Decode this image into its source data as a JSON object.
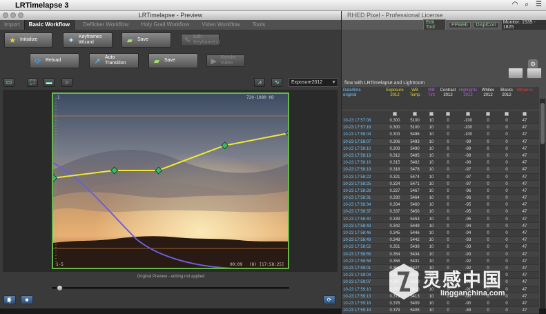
{
  "menubar": {
    "app_name": "LRTimelapse 3"
  },
  "bg_window": {
    "title": "RHED Pixel - Professional License",
    "chips": [
      "Edit Tool",
      "PPWeb",
      "DisplCorr"
    ],
    "monitor": "Monitor: 1535 - 1825",
    "caption": "flow with LRTimelapse and Lightroom"
  },
  "table": {
    "headers": [
      {
        "line1": "Date/time",
        "line2": "original",
        "cls": ""
      },
      {
        "line1": "Exposure",
        "line2": "2012",
        "cls": "exp"
      },
      {
        "line1": "WB",
        "line2": "Temp",
        "cls": "wb"
      },
      {
        "line1": "WB",
        "line2": "Tint",
        "cls": "tint"
      },
      {
        "line1": "Contrast",
        "line2": "2012",
        "cls": ""
      },
      {
        "line1": "Highlights",
        "line2": "2012",
        "cls": "hl"
      },
      {
        "line1": "Whites",
        "line2": "2012",
        "cls": ""
      },
      {
        "line1": "Blacks",
        "line2": "2012",
        "cls": ""
      },
      {
        "line1": "Vibrance",
        "line2": "",
        "cls": "vib"
      }
    ],
    "rows": [
      [
        "10-23 17:57:08",
        "0.300",
        "5100",
        "10",
        "0",
        "-100",
        "0",
        "0",
        "47"
      ],
      [
        "10-23 17:57:16",
        "0.300",
        "5100",
        "10",
        "0",
        "-100",
        "0",
        "0",
        "47"
      ],
      [
        "10-23 17:58:04",
        "0.303",
        "5496",
        "10",
        "0",
        "-100",
        "0",
        "0",
        "47"
      ],
      [
        "10-23 17:58:07",
        "0.306",
        "5493",
        "10",
        "0",
        "-99",
        "0",
        "0",
        "47"
      ],
      [
        "10-23 17:58:10",
        "0.309",
        "5490",
        "10",
        "0",
        "-99",
        "0",
        "0",
        "47"
      ],
      [
        "10-23 17:58:13",
        "0.312",
        "5485",
        "10",
        "0",
        "-98",
        "0",
        "0",
        "47"
      ],
      [
        "10-23 17:58:16",
        "0.315",
        "5482",
        "10",
        "0",
        "-98",
        "0",
        "0",
        "47"
      ],
      [
        "10-23 17:58:19",
        "0.318",
        "5478",
        "10",
        "0",
        "-97",
        "0",
        "0",
        "47"
      ],
      [
        "10-23 17:58:22",
        "0.321",
        "5474",
        "10",
        "0",
        "-97",
        "0",
        "0",
        "47"
      ],
      [
        "10-23 17:58:25",
        "0.324",
        "5471",
        "10",
        "0",
        "-97",
        "0",
        "0",
        "47"
      ],
      [
        "10-23 17:58:28",
        "0.327",
        "5467",
        "10",
        "0",
        "-96",
        "0",
        "0",
        "47"
      ],
      [
        "10-23 17:58:31",
        "0.330",
        "5464",
        "10",
        "0",
        "-96",
        "0",
        "0",
        "47"
      ],
      [
        "10-23 17:58:34",
        "0.334",
        "5460",
        "10",
        "0",
        "-95",
        "0",
        "0",
        "47"
      ],
      [
        "10-23 17:58:37",
        "0.337",
        "5456",
        "10",
        "0",
        "-95",
        "0",
        "0",
        "47"
      ],
      [
        "10-23 17:58:40",
        "0.339",
        "5453",
        "10",
        "0",
        "-95",
        "0",
        "0",
        "47"
      ],
      [
        "10-23 17:58:43",
        "0.342",
        "5449",
        "10",
        "0",
        "-94",
        "0",
        "0",
        "47"
      ],
      [
        "10-23 17:58:46",
        "0.345",
        "5446",
        "10",
        "0",
        "-94",
        "0",
        "0",
        "47"
      ],
      [
        "10-23 17:58:49",
        "0.348",
        "5442",
        "10",
        "0",
        "-93",
        "0",
        "0",
        "47"
      ],
      [
        "10-23 17:58:52",
        "0.351",
        "5438",
        "10",
        "0",
        "-93",
        "0",
        "0",
        "47"
      ],
      [
        "10-23 17:58:55",
        "0.354",
        "5434",
        "10",
        "0",
        "-93",
        "0",
        "0",
        "47"
      ],
      [
        "10-23 17:58:58",
        "0.358",
        "5431",
        "10",
        "0",
        "-92",
        "0",
        "0",
        "47"
      ],
      [
        "10-23 17:59:01",
        "0.361",
        "5427",
        "10",
        "0",
        "-92",
        "0",
        "0",
        "47"
      ],
      [
        "10-23 17:59:04",
        "0.364",
        "5424",
        "10",
        "0",
        "-91",
        "0",
        "0",
        "47"
      ],
      [
        "10-23 17:59:07",
        "0.367",
        "5420",
        "10",
        "0",
        "-91",
        "0",
        "0",
        "47"
      ],
      [
        "10-23 17:59:10",
        "0.370",
        "5416",
        "10",
        "0",
        "-91",
        "0",
        "0",
        "47"
      ],
      [
        "10-23 17:59:13",
        "0.373",
        "5413",
        "10",
        "0",
        "-90",
        "0",
        "0",
        "47"
      ],
      [
        "10-23 17:59:16",
        "0.376",
        "5409",
        "10",
        "0",
        "-90",
        "0",
        "0",
        "47"
      ],
      [
        "10-23 17:59:19",
        "0.379",
        "5405",
        "10",
        "0",
        "-89",
        "0",
        "0",
        "47"
      ]
    ]
  },
  "window": {
    "title": "LRTimelapse - Preview",
    "tabs": [
      {
        "label": "Import",
        "active": false
      },
      {
        "label": "Basic Workflow",
        "active": true
      },
      {
        "label": "Deflicker Workflow",
        "active": false
      },
      {
        "label": "Holy Grail Workflow",
        "active": false
      },
      {
        "label": "Video Workflow",
        "active": false
      },
      {
        "label": "Tools",
        "active": false
      }
    ]
  },
  "toolbar": {
    "initialize": "Initialize",
    "keyframes_1": "Keyframes",
    "keyframes_2": "Wizard",
    "save": "Save",
    "edit_1": "Edit",
    "edit_2": "Keyframe(s)",
    "reload": "Reload",
    "auto_1": "Auto",
    "auto_2": "Transition",
    "save2": "Save",
    "render": "Render Video"
  },
  "view": {
    "curve_select": "Exposure2012"
  },
  "preview": {
    "top_right_label": "720-1080 HD",
    "index_top": "1",
    "index_bottom": "1-5",
    "timecode": "00:09",
    "frame_info": "(8) [17:58:25]",
    "caption": "Original Preview - editing not applied"
  },
  "watermark": {
    "chinese": "灵感中国",
    "latin": "lingganchina.com"
  },
  "colors": {
    "curve_yellow": "#f2e832",
    "curve_blue": "#6a5fd8",
    "frame_green": "#67b84b",
    "keyframe_green": "#3bb56a",
    "orange_line": "#c87a3a"
  }
}
